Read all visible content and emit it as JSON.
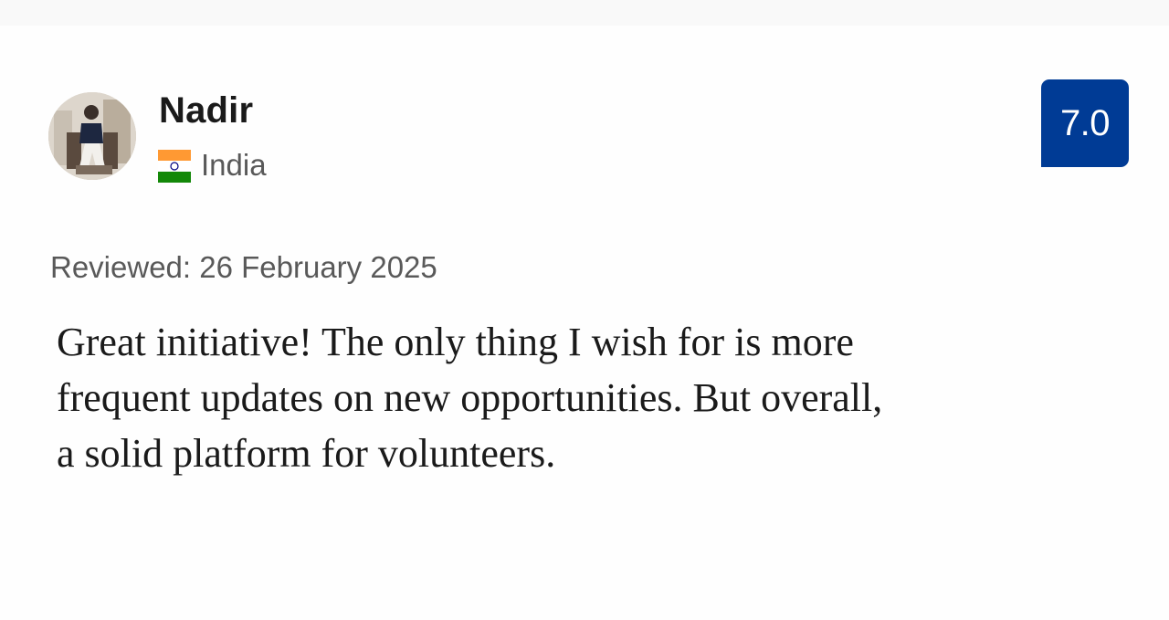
{
  "reviewer": {
    "name": "Nadir",
    "country": "India",
    "flag_icon": "india-flag-icon",
    "avatar_icon": "avatar-photo"
  },
  "score": {
    "value": "7.0",
    "badge_color": "#003b95"
  },
  "review": {
    "date_text": "Reviewed: 26 February 2025",
    "body": "Great initiative! The only thing I wish for is more frequent updates on new opportunities. But overall, a solid platform for volunteers."
  }
}
